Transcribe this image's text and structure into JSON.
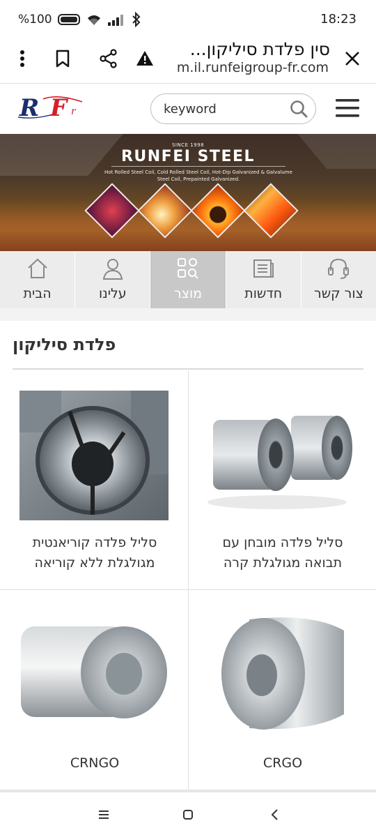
{
  "status_bar": {
    "battery": "%100",
    "time": "18:23"
  },
  "browser": {
    "page_title": "סין פלדת סיליקון...",
    "domain": "m.il.runfeigroup-fr.com",
    "icons": [
      "more-vert-icon",
      "bookmark-icon",
      "share-icon",
      "warning-icon",
      "close-icon"
    ]
  },
  "header": {
    "logo_text": "RF",
    "search_placeholder": "keyword"
  },
  "banner": {
    "since": "SINCE 1998",
    "title": "RUNFEI STEEL",
    "subtitle": "Hot Rolled Steel Coil, Cold Rolled Steel Coil, Hot-Dip Galvanized & Galvalume Steel Coil, Prepainted Galvanized."
  },
  "nav_tabs": [
    {
      "label": "הבית",
      "icon": "home-icon",
      "active": false
    },
    {
      "label": "עלינו",
      "icon": "user-icon",
      "active": false
    },
    {
      "label": "מוצר",
      "icon": "product-grid-icon",
      "active": true
    },
    {
      "label": "חדשות",
      "icon": "news-icon",
      "active": false
    },
    {
      "label": "צור קשר",
      "icon": "headset-icon",
      "active": false
    }
  ],
  "section": {
    "title": "פלדת סיליקון"
  },
  "products": [
    {
      "name_line1": "סליל פלדה קוריאנטית",
      "name_line2": "מגולגלת ללא קוריאה"
    },
    {
      "name_line1": "סליל פלדה מובחן עם",
      "name_line2": "תבואה מגולגלת קרה"
    },
    {
      "name_line1": "CRNGO",
      "name_line2": ""
    },
    {
      "name_line1": "CRGO",
      "name_line2": ""
    }
  ],
  "colors": {
    "accent_active_tab": "#c8c8c8",
    "logo_blue": "#1b2f6e",
    "logo_red": "#d21f2a"
  }
}
